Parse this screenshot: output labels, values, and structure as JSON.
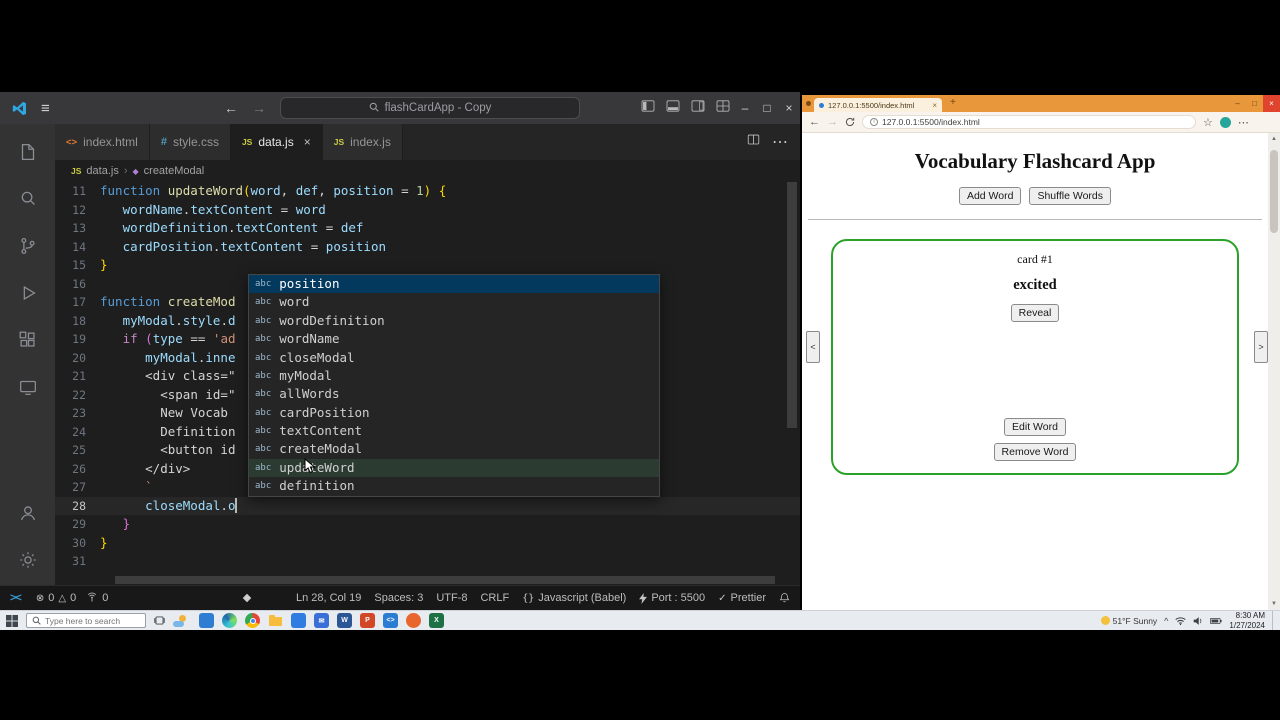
{
  "colors": {
    "vscode_bg": "#1e1e1e",
    "suggest_selection": "#04395e",
    "card_border_green": "#2aa22a",
    "browser_theme_orange": "#e8973b",
    "js_icon_yellow": "#cbcb41"
  },
  "vscode": {
    "titlebar": {
      "search": "flashCardApp - Copy"
    },
    "file_icons": {
      "html": "<>",
      "css": "#",
      "js": "JS"
    },
    "tabs": [
      {
        "label": "index.html",
        "icon": "html",
        "active": false
      },
      {
        "label": "style.css",
        "icon": "css",
        "active": false
      },
      {
        "label": "data.js",
        "icon": "js",
        "active": true
      },
      {
        "label": "index.js",
        "icon": "js",
        "active": false
      }
    ],
    "breadcrumb": [
      "data.js",
      "createModal"
    ],
    "code": {
      "lines": [
        {
          "n": 11,
          "seg": [
            [
              "kw",
              "function "
            ],
            [
              "fn",
              "updateWord"
            ],
            [
              "b1",
              "("
            ],
            [
              "vr",
              "word"
            ],
            [
              "pl",
              ", "
            ],
            [
              "vr",
              "def"
            ],
            [
              "pl",
              ", "
            ],
            [
              "vr",
              "position"
            ],
            [
              "pl",
              " = "
            ],
            [
              "nm",
              "1"
            ],
            [
              "b1",
              ")"
            ],
            [
              "pl",
              " "
            ],
            [
              "b1",
              "{"
            ]
          ]
        },
        {
          "n": 12,
          "seg": [
            [
              "pl",
              "   "
            ],
            [
              "vr",
              "wordName"
            ],
            [
              "pl",
              "."
            ],
            [
              "vr",
              "textContent"
            ],
            [
              "pl",
              " = "
            ],
            [
              "vr",
              "word"
            ]
          ]
        },
        {
          "n": 13,
          "seg": [
            [
              "pl",
              "   "
            ],
            [
              "vr",
              "wordDefinition"
            ],
            [
              "pl",
              "."
            ],
            [
              "vr",
              "textContent"
            ],
            [
              "pl",
              " = "
            ],
            [
              "vr",
              "def"
            ]
          ]
        },
        {
          "n": 14,
          "seg": [
            [
              "pl",
              "   "
            ],
            [
              "vr",
              "cardPosition"
            ],
            [
              "pl",
              "."
            ],
            [
              "vr",
              "textContent"
            ],
            [
              "pl",
              " = "
            ],
            [
              "vr",
              "position"
            ]
          ]
        },
        {
          "n": 15,
          "seg": [
            [
              "b1",
              "}"
            ]
          ]
        },
        {
          "n": 16,
          "seg": []
        },
        {
          "n": 17,
          "seg": [
            [
              "kw",
              "function "
            ],
            [
              "fn",
              "createMod"
            ]
          ]
        },
        {
          "n": 18,
          "seg": [
            [
              "pl",
              "   "
            ],
            [
              "vr",
              "myModal"
            ],
            [
              "pl",
              "."
            ],
            [
              "vr",
              "style"
            ],
            [
              "pl",
              "."
            ],
            [
              "vr",
              "d"
            ]
          ]
        },
        {
          "n": 19,
          "seg": [
            [
              "pl",
              "   "
            ],
            [
              "ct",
              "if"
            ],
            [
              "pl",
              " "
            ],
            [
              "b2",
              "("
            ],
            [
              "vr",
              "type"
            ],
            [
              "pl",
              " == "
            ],
            [
              "st",
              "'ad"
            ]
          ]
        },
        {
          "n": 20,
          "seg": [
            [
              "pl",
              "      "
            ],
            [
              "vr",
              "myModal"
            ],
            [
              "pl",
              "."
            ],
            [
              "vr",
              "inne"
            ]
          ]
        },
        {
          "n": 21,
          "seg": [
            [
              "pl",
              "      "
            ],
            [
              "ht",
              "<div class=\""
            ]
          ]
        },
        {
          "n": 22,
          "seg": [
            [
              "pl",
              "        "
            ],
            [
              "ht",
              "<span id=\""
            ]
          ]
        },
        {
          "n": 23,
          "seg": [
            [
              "pl",
              "        "
            ],
            [
              "ht",
              "New Vocab"
            ]
          ]
        },
        {
          "n": 24,
          "seg": [
            [
              "pl",
              "        "
            ],
            [
              "ht",
              "Definition"
            ]
          ]
        },
        {
          "n": 25,
          "seg": [
            [
              "pl",
              "        "
            ],
            [
              "ht",
              "<button id"
            ]
          ]
        },
        {
          "n": 26,
          "seg": [
            [
              "pl",
              "      "
            ],
            [
              "ht",
              "</div>"
            ]
          ]
        },
        {
          "n": 27,
          "seg": [
            [
              "pl",
              "      "
            ],
            [
              "st",
              "`"
            ]
          ]
        },
        {
          "n": 28,
          "cursor": true,
          "current": true,
          "seg": [
            [
              "pl",
              "      "
            ],
            [
              "vr",
              "closeModal"
            ],
            [
              "pl",
              "."
            ],
            [
              "vr",
              "o"
            ]
          ]
        },
        {
          "n": 29,
          "seg": [
            [
              "pl",
              "   "
            ],
            [
              "b2",
              "}"
            ]
          ]
        },
        {
          "n": 30,
          "seg": [
            [
              "b1",
              "}"
            ]
          ]
        },
        {
          "n": 31,
          "seg": []
        }
      ]
    },
    "suggest": {
      "kind_icon": "abc",
      "items": [
        {
          "label": "position",
          "state": "sel"
        },
        {
          "label": "word"
        },
        {
          "label": "wordDefinition"
        },
        {
          "label": "wordName"
        },
        {
          "label": "closeModal"
        },
        {
          "label": "myModal"
        },
        {
          "label": "allWords"
        },
        {
          "label": "cardPosition"
        },
        {
          "label": "textContent"
        },
        {
          "label": "createModal"
        },
        {
          "label": "updateWord",
          "state": "hov"
        },
        {
          "label": "definition"
        }
      ]
    },
    "status": {
      "errors": "0",
      "warnings": "0",
      "ports": "0",
      "right": [
        {
          "label": "Ln 28, Col 19"
        },
        {
          "label": "Spaces: 3"
        },
        {
          "label": "UTF-8"
        },
        {
          "label": "CRLF"
        },
        {
          "icon": "braces",
          "label": "Javascript (Babel)"
        },
        {
          "icon": "bolt",
          "label": "Port : 5500"
        },
        {
          "icon": "check",
          "label": "Prettier"
        },
        {
          "icon": "bell",
          "label": ""
        }
      ]
    }
  },
  "browser": {
    "tab_title": "127.0.0.1:5500/index.html",
    "address": "127.0.0.1:5500/index.html",
    "page": {
      "title": "Vocabulary Flashcard App",
      "add_button": "Add Word",
      "shuffle_button": "Shuffle Words",
      "card_position": "card #1",
      "word": "excited",
      "reveal_button": "Reveal",
      "edit_button": "Edit Word",
      "remove_button": "Remove Word",
      "prev": "<",
      "next": ">"
    }
  },
  "taskbar": {
    "search_placeholder": "Type here to search",
    "apps": [
      {
        "name": "chat-app",
        "type": "plain",
        "color": "#2d7dd2"
      },
      {
        "name": "edge-browser",
        "type": "edge"
      },
      {
        "name": "chrome-browser",
        "type": "chrome"
      },
      {
        "name": "file-explorer",
        "type": "folder"
      },
      {
        "name": "store-app",
        "type": "plain",
        "color": "#2f7de1"
      },
      {
        "name": "mail-app",
        "type": "plain",
        "color": "#3a6fd8",
        "glyph": "✉"
      },
      {
        "name": "word-app",
        "type": "plain",
        "color": "#2b5797",
        "glyph": "W"
      },
      {
        "name": "powerpoint-app",
        "type": "plain",
        "color": "#d24726",
        "glyph": "P"
      },
      {
        "name": "vscode-app",
        "type": "plain",
        "color": "#2b7cd3",
        "glyph": "<>"
      },
      {
        "name": "firefox-browser",
        "type": "circle",
        "color": "#e8662c"
      },
      {
        "name": "excel-app",
        "type": "plain",
        "color": "#1e7145",
        "glyph": "X"
      }
    ],
    "tray": {
      "weather": "51°F Sunny",
      "time": "8:30 AM",
      "date": "1/27/2024"
    }
  }
}
